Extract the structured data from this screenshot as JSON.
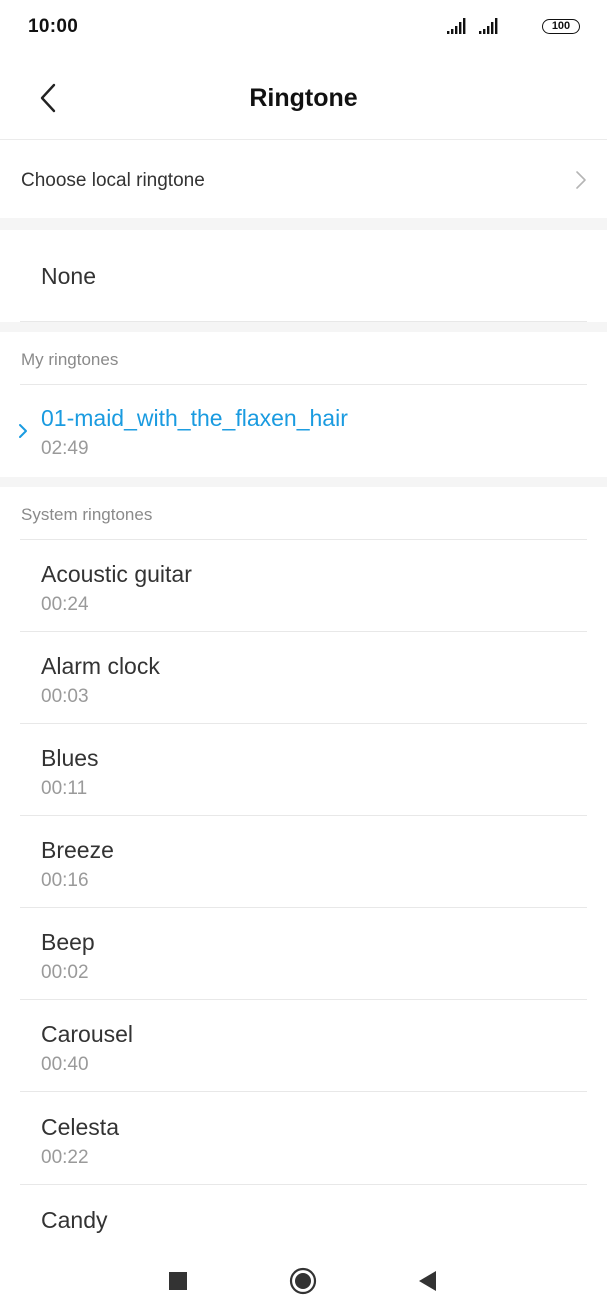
{
  "status_bar": {
    "time": "10:00",
    "battery": "100"
  },
  "header": {
    "title": "Ringtone"
  },
  "local": {
    "label": "Choose local ringtone"
  },
  "none_option": {
    "label": "None"
  },
  "my_ringtones": {
    "header": "My ringtones",
    "items": [
      {
        "title": "01-maid_with_the_flaxen_hair",
        "duration": "02:49",
        "selected": true
      }
    ]
  },
  "system_ringtones": {
    "header": "System ringtones",
    "items": [
      {
        "title": "Acoustic guitar",
        "duration": "00:24"
      },
      {
        "title": "Alarm clock",
        "duration": "00:03"
      },
      {
        "title": "Blues",
        "duration": "00:11"
      },
      {
        "title": "Breeze",
        "duration": "00:16"
      },
      {
        "title": "Beep",
        "duration": "00:02"
      },
      {
        "title": "Carousel",
        "duration": "00:40"
      },
      {
        "title": "Celesta",
        "duration": "00:22"
      },
      {
        "title": "Candy",
        "duration": ""
      }
    ]
  },
  "colors": {
    "accent": "#1a9be0",
    "section_gap": "#f5f5f5",
    "divider": "#e8e8e8"
  },
  "icons": {
    "back": "chevron-left-icon",
    "local_arrow": "chevron-right-icon",
    "selected_marker": "chevron-right-icon",
    "nav_recents": "square-icon",
    "nav_home": "circle-icon",
    "nav_back": "triangle-left-icon"
  }
}
